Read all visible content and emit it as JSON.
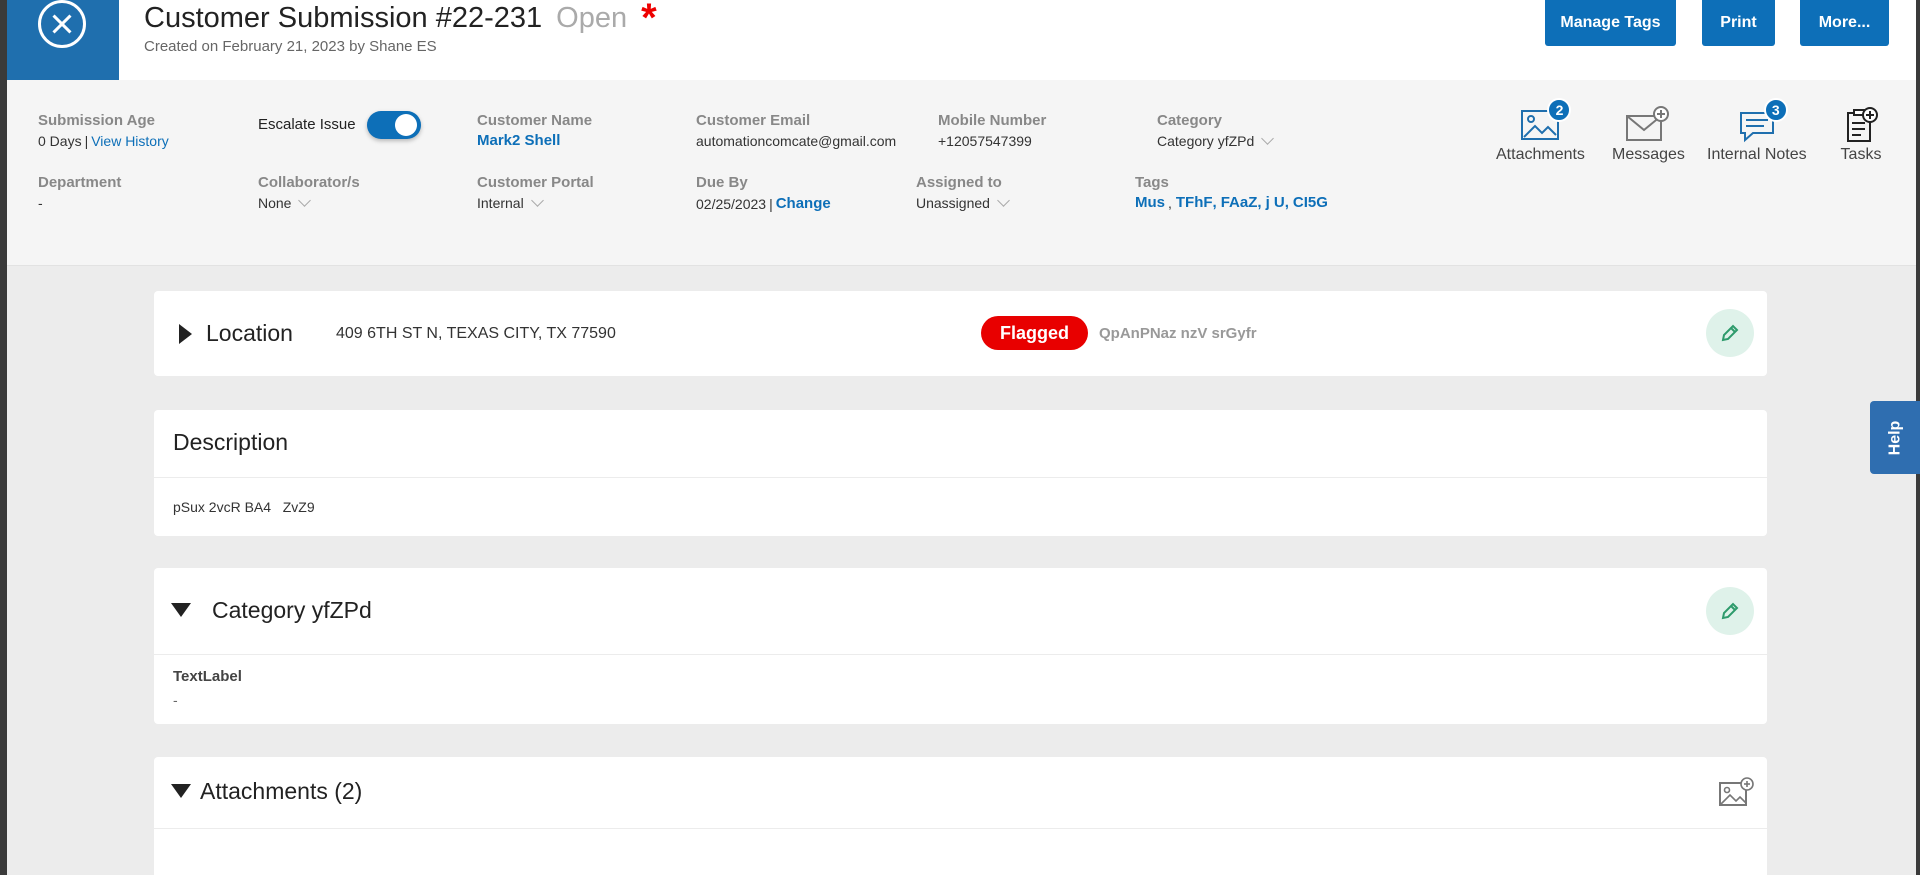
{
  "header": {
    "title": "Customer Submission #22-231",
    "status": "Open",
    "required_mark": "*",
    "subtitle": "Created on February 21, 2023 by Shane ES",
    "buttons": {
      "manage_tags": "Manage Tags",
      "print": "Print",
      "more": "More..."
    }
  },
  "info": {
    "submission_age": {
      "label": "Submission Age",
      "value": "0 Days",
      "separator": "|",
      "link": "View History"
    },
    "escalate": {
      "label": "Escalate Issue",
      "on": true
    },
    "customer_name": {
      "label": "Customer Name",
      "value": "Mark2 Shell"
    },
    "customer_email": {
      "label": "Customer Email",
      "value": "automationcomcate@gmail.com"
    },
    "mobile": {
      "label": "Mobile Number",
      "value": "+12057547399"
    },
    "category": {
      "label": "Category",
      "value": "Category yfZPd"
    },
    "department": {
      "label": "Department",
      "value": "-"
    },
    "collaborators": {
      "label": "Collaborator/s",
      "value": "None"
    },
    "portal": {
      "label": "Customer Portal",
      "value": "Internal"
    },
    "due_by": {
      "label": "Due By",
      "value": "02/25/2023",
      "separator": "|",
      "link": "Change"
    },
    "assigned_to": {
      "label": "Assigned to",
      "value": "Unassigned"
    },
    "tags": {
      "label": "Tags",
      "values": [
        "Mus",
        "TFhF",
        "FAaZ",
        "j U",
        "CI5G"
      ]
    }
  },
  "tools": {
    "attachments": {
      "label": "Attachments",
      "count": "2"
    },
    "messages": {
      "label": "Messages"
    },
    "internal_notes": {
      "label": "Internal Notes",
      "count": "3"
    },
    "tasks": {
      "label": "Tasks"
    }
  },
  "location": {
    "title": "Location",
    "address": "409 6TH ST N, TEXAS CITY, TX 77590",
    "flag": "Flagged",
    "flag_note": "QpAnPNaz nzV srGyfr"
  },
  "description": {
    "title": "Description",
    "text": "pSux 2vcR BA4   ZvZ9"
  },
  "category_section": {
    "title": "Category yfZPd",
    "field_label": "TextLabel",
    "field_value": "-"
  },
  "attachments_section": {
    "title": "Attachments (2)"
  },
  "help": {
    "label": "Help"
  },
  "colors": {
    "primary": "#0d6fb8",
    "flag": "#e80000",
    "edit_bg": "#dff2ea",
    "edit_icon": "#2e9b6c"
  }
}
